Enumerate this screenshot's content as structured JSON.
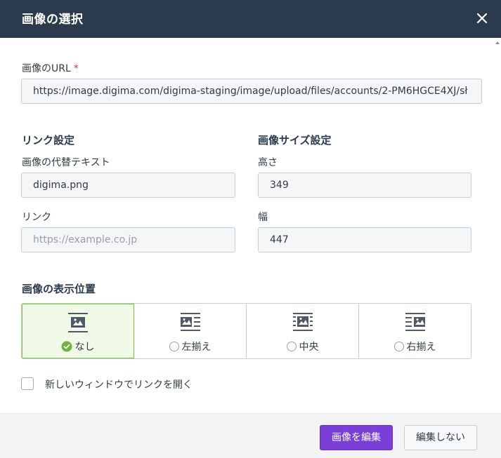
{
  "dialog": {
    "title": "画像の選択",
    "close_icon": "close-icon"
  },
  "url_field": {
    "label": "画像のURL",
    "required_mark": "*",
    "value": "https://image.digima.com/digima-staging/image/upload/files/accounts/2-PM6HGCE4XJ/sł"
  },
  "link_settings": {
    "title": "リンク設定",
    "alt_label": "画像の代替テキスト",
    "alt_value": "digima.png",
    "link_label": "リンク",
    "link_placeholder": "https://example.co.jp",
    "link_value": ""
  },
  "size_settings": {
    "title": "画像サイズ設定",
    "height_label": "高さ",
    "height_value": "349",
    "width_label": "幅",
    "width_value": "447"
  },
  "position": {
    "title": "画像の表示位置",
    "options": [
      {
        "label": "なし",
        "icon": "align-none-icon",
        "selected": true
      },
      {
        "label": "左揃え",
        "icon": "align-left-icon",
        "selected": false
      },
      {
        "label": "中央",
        "icon": "align-center-icon",
        "selected": false
      },
      {
        "label": "右揃え",
        "icon": "align-right-icon",
        "selected": false
      }
    ]
  },
  "new_window": {
    "label": "新しいウィンドウでリンクを開く",
    "checked": false
  },
  "footer": {
    "edit_label": "画像を編集",
    "cancel_label": "編集しない"
  },
  "colors": {
    "header_bg": "#2c3a4d",
    "accent_green": "#7cc33f",
    "primary_purple": "#7a3fd6",
    "required_red": "#d93a2b"
  }
}
